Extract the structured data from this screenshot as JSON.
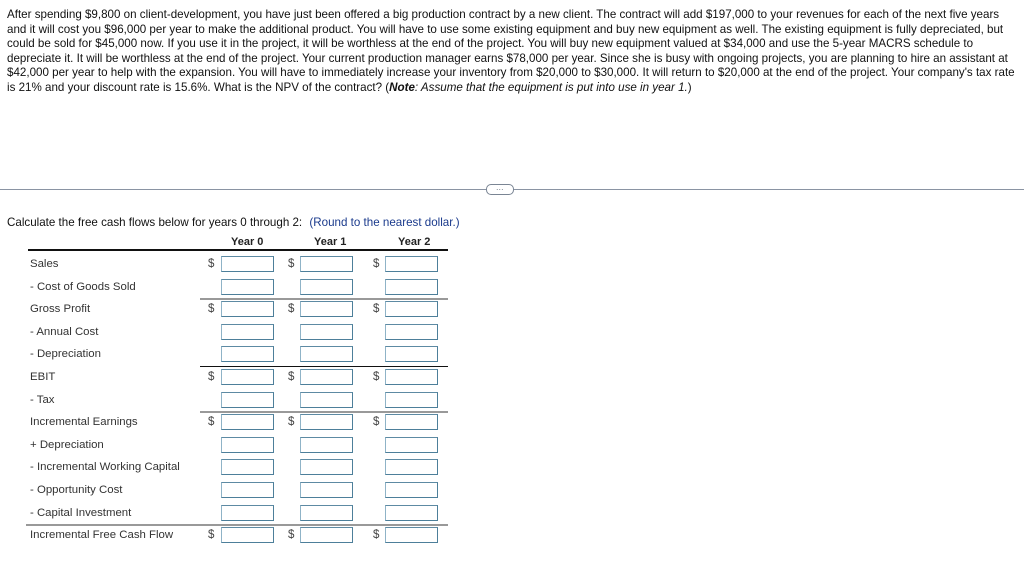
{
  "problem": {
    "text_main": "After spending $9,800 on client-development, you have just been offered a big production contract by a new client. The contract will add $197,000 to your revenues for each of the next five years and it will cost you $96,000 per year to make the additional product. You will have to use some existing equipment and buy new equipment as well. The existing equipment is fully depreciated, but could be sold for $45,000 now. If you use it in the project, it will be worthless at the end of the project. You will buy new equipment valued at $34,000 and use the 5-year MACRS schedule to depreciate it. It will be worthless at the end of the project. Your current production manager earns $78,000 per year. Since she is busy with ongoing projects, you are planning to hire an assistant at $42,000 per year to help with the expansion. You will have to immediately increase your inventory from $20,000 to $30,000. It will return to $20,000 at the end of the project. Your company's tax rate is 21% and your discount rate is 15.6%. What is the NPV of the contract? (",
    "note_label": "Note",
    "note_text": ": Assume that the equipment is put into use in year 1.",
    "close_paren": ")"
  },
  "more_button": "…",
  "instructions": {
    "text": "Calculate the free cash flows below for years 0 through 2:",
    "hint": "(Round to the nearest dollar.)"
  },
  "table": {
    "columns": [
      "Year 0",
      "Year 1",
      "Year 2"
    ],
    "currency_symbol": "$",
    "rows": [
      {
        "label": "Sales",
        "dollar": true,
        "values": [
          "",
          "",
          ""
        ]
      },
      {
        "label": "- Cost of Goods Sold",
        "dollar": false,
        "values": [
          "",
          "",
          ""
        ]
      },
      {
        "label": "Gross Profit",
        "dollar": true,
        "values": [
          "",
          "",
          ""
        ]
      },
      {
        "label": "- Annual Cost",
        "dollar": false,
        "values": [
          "",
          "",
          ""
        ]
      },
      {
        "label": "- Depreciation",
        "dollar": false,
        "values": [
          "",
          "",
          ""
        ]
      },
      {
        "label": "EBIT",
        "dollar": true,
        "values": [
          "",
          "",
          ""
        ]
      },
      {
        "label": "- Tax",
        "dollar": false,
        "values": [
          "",
          "",
          ""
        ]
      },
      {
        "label": "Incremental Earnings",
        "dollar": true,
        "values": [
          "",
          "",
          ""
        ]
      },
      {
        "label": "+ Depreciation",
        "dollar": false,
        "values": [
          "",
          "",
          ""
        ]
      },
      {
        "label": "- Incremental Working Capital",
        "dollar": false,
        "values": [
          "",
          "",
          ""
        ]
      },
      {
        "label": "- Opportunity Cost",
        "dollar": false,
        "values": [
          "",
          "",
          ""
        ]
      },
      {
        "label": "- Capital Investment",
        "dollar": false,
        "values": [
          "",
          "",
          ""
        ]
      },
      {
        "label": "Incremental Free Cash Flow",
        "dollar": true,
        "values": [
          "",
          "",
          ""
        ]
      }
    ]
  }
}
